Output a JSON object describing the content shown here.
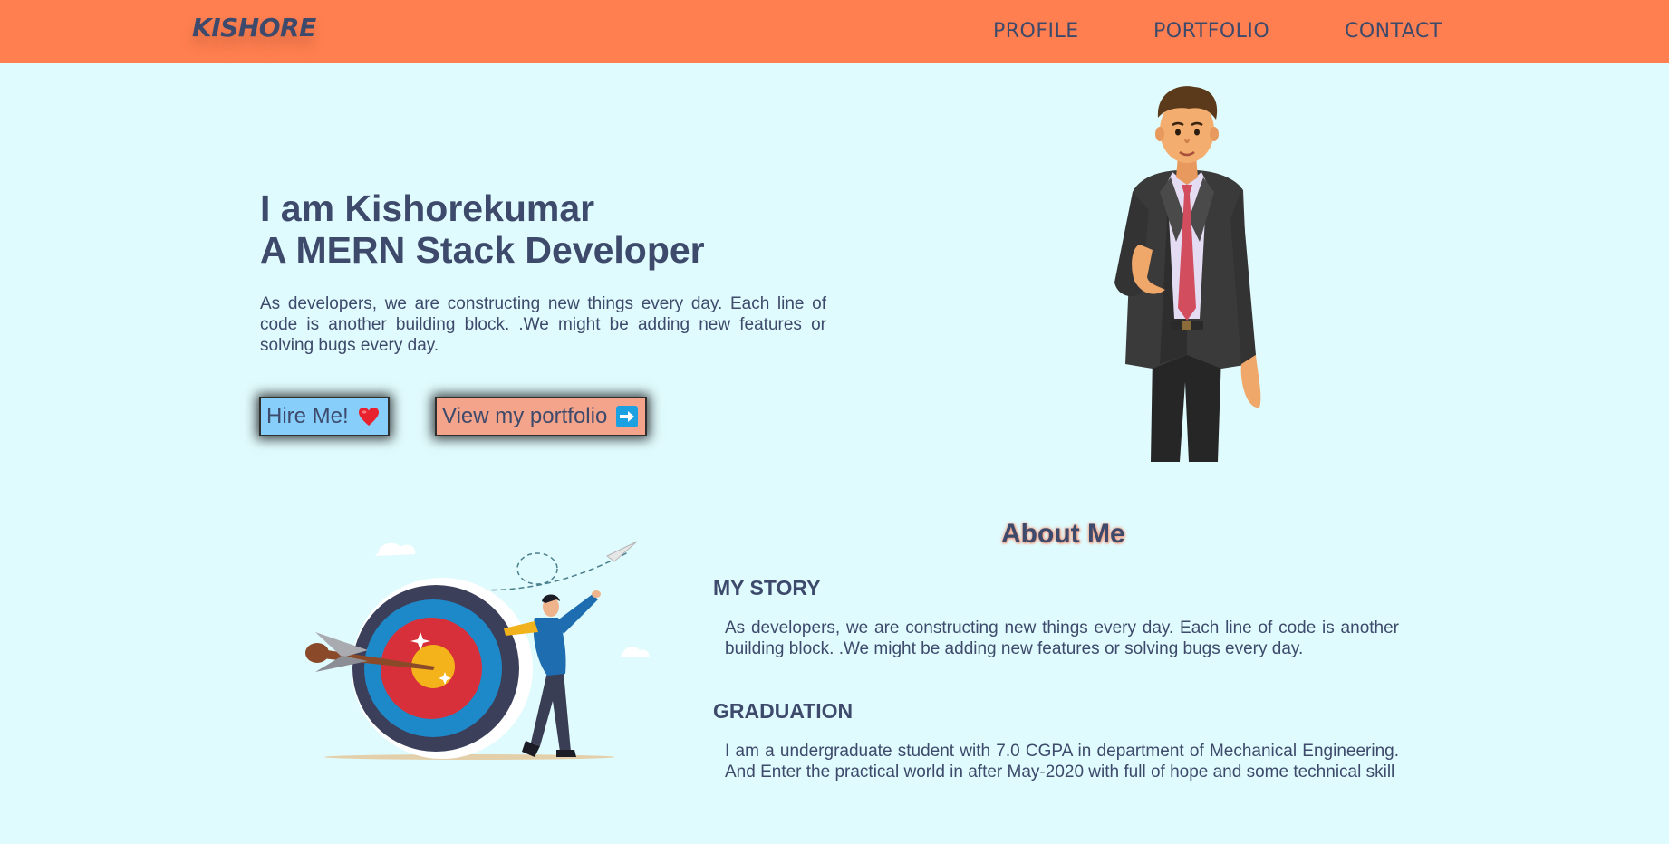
{
  "nav": {
    "brand": "KISHORE",
    "links": [
      "PROFILE",
      "PORTFOLIO",
      "CONTACT"
    ]
  },
  "hero": {
    "title_line1": "I am Kishorekumar",
    "title_line2": "A MERN Stack Developer",
    "text": "As developers, we are constructing new things every day. Each line of code is another building block. .We might be adding new features or solving bugs every day.",
    "hire_button": "Hire Me!",
    "hire_icon": "heart-icon",
    "portfolio_button": "View my portfolio",
    "portfolio_icon": "right-arrow-icon"
  },
  "about": {
    "title": "About Me",
    "story_heading": "MY STORY",
    "story_text": "As developers, we are constructing new things every day. Each line of code is another building block. .We might be adding new features or solving bugs every day.",
    "graduation_heading": "GRADUATION",
    "graduation_text": "I am a undergraduate student with 7.0 CGPA in department of Mechanical Engineering. And Enter the practical world in after May-2020 with full of hope and some technical skill"
  },
  "colors": {
    "navbar": "#ff7f50",
    "background": "#e0fbfd",
    "text": "#3d4a6b",
    "hire_button": "#87cefa",
    "portfolio_button": "#f4a48a"
  }
}
